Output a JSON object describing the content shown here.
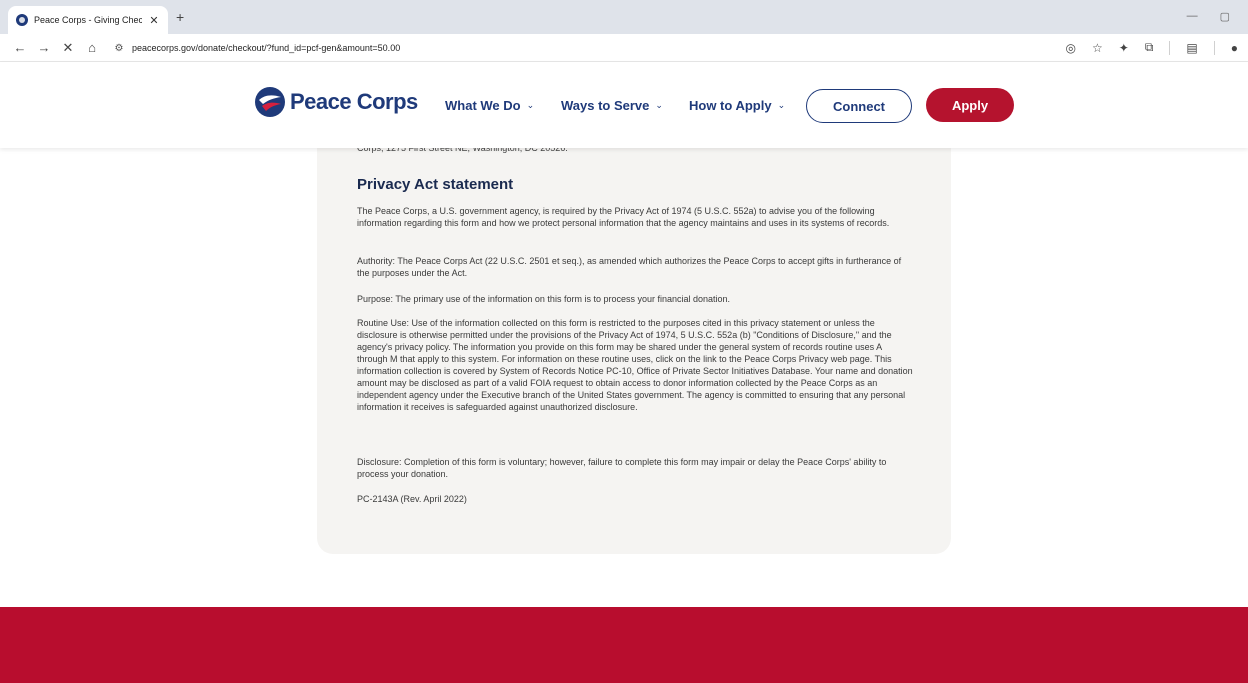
{
  "browser": {
    "tab_title": "Peace Corps - Giving Checkout",
    "tab_close": "✕",
    "new_tab": "+",
    "url": "peacecorps.gov/donate/checkout/?fund_id=pcf-gen&amount=50.00"
  },
  "header": {
    "logo_text": "Peace Corps",
    "nav": [
      {
        "label": "What We Do",
        "chevron": "⌄"
      },
      {
        "label": "Ways to Serve",
        "chevron": "⌄"
      },
      {
        "label": "How to Apply",
        "chevron": "⌄"
      }
    ],
    "connect_label": "Connect",
    "apply_label": "Apply",
    "brand_blue": "#1f3a7a",
    "brand_red": "#b5132e"
  },
  "content": {
    "cut_line": "Corps, 1275 First Street NE, Washington, DC 20526.",
    "heading": "Privacy Act statement",
    "paragraphs": [
      "The Peace Corps, a U.S. government agency, is required by the Privacy Act of 1974 (5 U.S.C. 552a) to advise you of the following information regarding this form and how we protect personal information that the agency maintains and uses in its systems of records.",
      "Authority: The Peace Corps Act (22 U.S.C. 2501 et seq.), as amended which authorizes the Peace Corps to accept gifts in furtherance of the purposes under the Act.",
      "Purpose: The primary use of the information on this form is to process your financial donation.",
      "Routine Use: Use of the information collected on this form is restricted to the purposes cited in this privacy statement or unless the disclosure is otherwise permitted under the provisions of the Privacy Act of 1974, 5 U.S.C. 552a (b) \"Conditions of Disclosure,\" and the agency's privacy policy. The information you provide on this form may be shared under the general system of records routine uses A through M that apply to this system. For information on these routine uses, click on the link to the Peace Corps Privacy web page. This information collection is covered by System of Records Notice PC-10, Office of Private Sector Initiatives Database. Your name and donation amount may be disclosed as part of a valid FOIA request to obtain access to donor information collected by the Peace Corps as an independent agency under the Executive branch of the United States government. The agency is committed to ensuring that any personal information it receives is safeguarded against unauthorized disclosure.",
      "Disclosure: Completion of this form is voluntary; however, failure to complete this form may impair or delay the Peace Corps' ability to process your donation.",
      "PC-2143A (Rev. April 2022)"
    ]
  },
  "footer": {
    "color": "#b80d2e"
  }
}
